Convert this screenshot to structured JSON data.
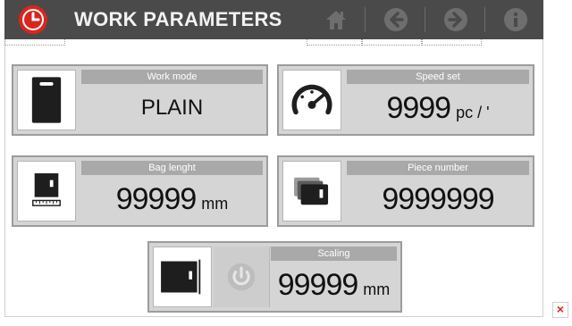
{
  "header": {
    "title": "WORK PARAMETERS",
    "nav": [
      {
        "name": "home-icon"
      },
      {
        "name": "arrow-left-icon"
      },
      {
        "name": "arrow-right-icon"
      },
      {
        "name": "info-icon"
      }
    ],
    "colors": {
      "bar": "#4a4a4a",
      "accent": "#d9261c"
    }
  },
  "cards": {
    "work_mode": {
      "label": "Work mode",
      "value": "PLAIN",
      "icon": "bag-plain-icon"
    },
    "speed_set": {
      "label": "Speed set",
      "value": "9999",
      "unit": "pc / '",
      "icon": "speedometer-icon"
    },
    "bag_length": {
      "label": "Bag lenght",
      "value": "99999",
      "unit": "mm",
      "icon": "bag-length-icon"
    },
    "piece_number": {
      "label": "Piece number",
      "value": "9999999",
      "icon": "stacked-bags-icon"
    },
    "scaling": {
      "label": "Scaling",
      "value": "99999",
      "unit": "mm",
      "icon": "scaling-bag-icon",
      "power_icon": "power-icon"
    }
  },
  "close": {
    "label": "×"
  }
}
